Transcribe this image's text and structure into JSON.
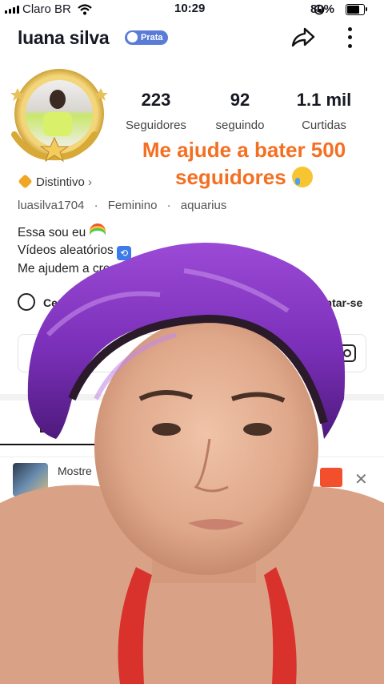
{
  "status_bar": {
    "carrier": "Claro BR",
    "time": "10:29",
    "battery": "80%"
  },
  "header": {
    "username": "luana silva",
    "badge": "Prata"
  },
  "stats": [
    {
      "value": "223",
      "label": "Seguidores"
    },
    {
      "value": "92",
      "label": "seguindo"
    },
    {
      "value": "1.1 mil",
      "label": "Curtidas"
    }
  ],
  "overlay": {
    "line1": "Me ajude a bater 500",
    "line2": "seguidores"
  },
  "distintivo": "Distintivo",
  "meta": {
    "handle": "luasilva1704",
    "gender": "Feminino",
    "sign": "aquarius"
  },
  "bio": {
    "line1": "Essa sou eu",
    "line2": "Vídeos aleatórios",
    "line3": "Me ajudem a crescer a"
  },
  "row": {
    "center": "Centr",
    "join": "untar-se"
  },
  "promo": {
    "text": "Mostre"
  },
  "colors": {
    "overlay_text": "#f46f22",
    "badge": "#5b7cd6",
    "satin": "#7a2fb8"
  }
}
